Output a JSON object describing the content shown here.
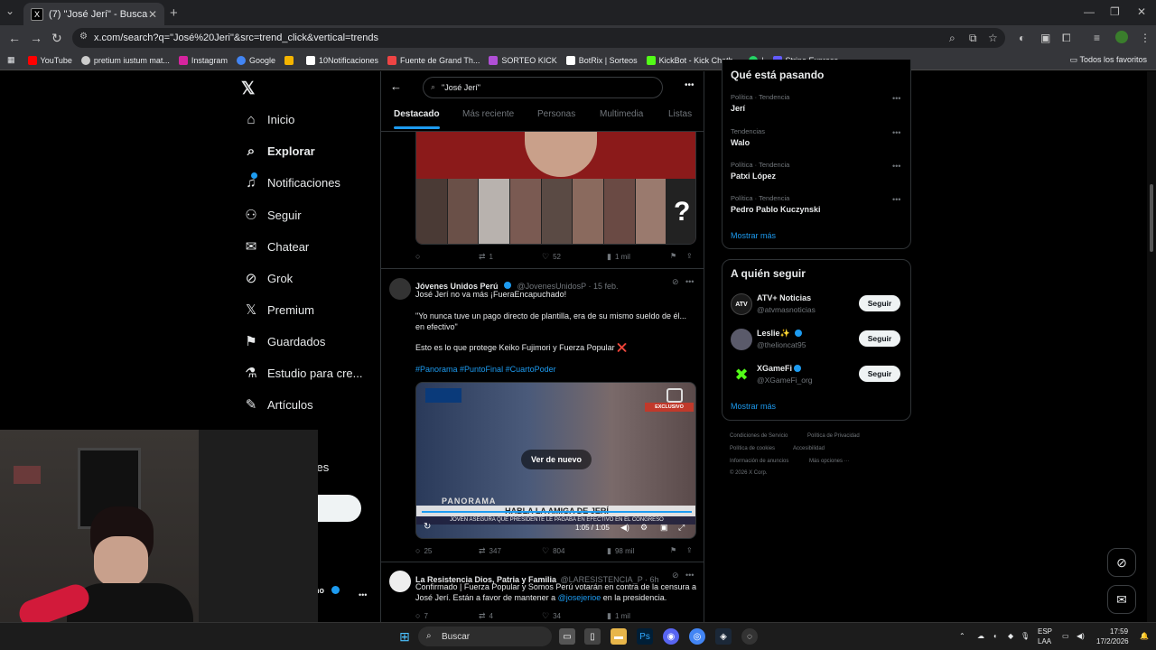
{
  "browser": {
    "tab_title": "(7) \"José Jerí\" - Buscar / X",
    "url": "x.com/search?q=\"José%20Jeri\"&src=trend_click&vertical=trends",
    "bookmarks": [
      {
        "label": "YouTube",
        "color": "#ff0000"
      },
      {
        "label": "pretium iustum mat...",
        "color": "#cccccc"
      },
      {
        "label": "Instagram",
        "color": "#d6249f"
      },
      {
        "label": "Google",
        "color": "#4285f4"
      },
      {
        "label": "",
        "color": "#f4b400"
      },
      {
        "label": "10Notificaciones",
        "color": "#ffffff"
      },
      {
        "label": "Fuente de Grand Th...",
        "color": "#e44"
      },
      {
        "label": "SORTEO KICK",
        "color": "#b04fd6"
      },
      {
        "label": "BotRix | Sorteos",
        "color": "#ffffff"
      },
      {
        "label": "KickBot - Kick Chatb...",
        "color": "#53fc18"
      },
      {
        "label": "|",
        "color": "#25d366"
      },
      {
        "label": "Stripe Express",
        "color": "#635bff"
      }
    ],
    "bookmarks_all": "Todos los favoritos"
  },
  "sidebar": {
    "items": [
      {
        "label": "Inicio",
        "icon": "home-icon"
      },
      {
        "label": "Explorar",
        "icon": "search-icon"
      },
      {
        "label": "Notificaciones",
        "icon": "bell-icon"
      },
      {
        "label": "Seguir",
        "icon": "add-user-icon"
      },
      {
        "label": "Chatear",
        "icon": "mail-icon"
      },
      {
        "label": "Grok",
        "icon": "grok-icon"
      },
      {
        "label": "Premium",
        "icon": "x-icon"
      },
      {
        "label": "Guardados",
        "icon": "bookmark-icon"
      },
      {
        "label": "Estudio para cre...",
        "icon": "flask-icon"
      },
      {
        "label": "Artículos",
        "icon": "article-icon"
      }
    ],
    "partial_label": "ones",
    "profile_partial": "ano"
  },
  "search": {
    "query": "\"José Jerí\"",
    "tabs": [
      "Destacado",
      "Más reciente",
      "Personas",
      "Multimedia",
      "Listas"
    ]
  },
  "tweets": [
    {
      "replies": "",
      "retweets": "1",
      "likes": "52",
      "views": "1 mil"
    },
    {
      "name": "Jóvenes Unidos Perú",
      "handle": "@JovenesUnidosP · 15 feb.",
      "line1": "José Jerí no va más ¡FueraEncapuchado!",
      "quote": "\"Yo nunca tuve un pago directo de plantilla, era de su mismo sueldo de él... en efectivo\"",
      "line3": "Esto es lo que protege Keiko Fujimori y Fuerza Popular ❌",
      "hashtags": "#Panorama #PuntoFinal #CuartoPoder",
      "video_replay": "Ver de nuevo",
      "video_time": "1:05 / 1:05",
      "video_caption": "HABLA LA AMIGA DE JERÍ",
      "video_sub": "JOVEN ASEGURA QUE PRESIDENTE LE PAGABA EN EFECTIVO EN EL CONGRESO",
      "video_brand": "PANORAMA",
      "video_badge": "EXCLUSIVO",
      "replies": "25",
      "retweets": "347",
      "likes": "804",
      "views": "98 mil"
    },
    {
      "name": "La Resistencia Dios, Patria y Familia",
      "handle": "@LARESISTENCIA_P · 6h",
      "text_a": "Confirmado | Fuerza Popular y Somos Perú votarán en contra de la censura a José Jerí. Están a favor de mantener a ",
      "mention": "@josejerioe",
      "text_b": " en la presidencia.",
      "replies": "7",
      "retweets": "4",
      "likes": "34",
      "views": "1 mil"
    }
  ],
  "trends": {
    "title": "Qué está pasando",
    "items": [
      {
        "meta": "Política · Tendencia",
        "name": "Jerí"
      },
      {
        "meta": "Tendencias",
        "name": "Walo"
      },
      {
        "meta": "Política · Tendencia",
        "name": "Patxi López"
      },
      {
        "meta": "Política · Tendencia",
        "name": "Pedro Pablo Kuczynski"
      }
    ],
    "more": "Mostrar más"
  },
  "who_to_follow": {
    "title": "A quién seguir",
    "accounts": [
      {
        "name": "ATV+ Noticias",
        "handle": "@atvmasnoticias",
        "button": "Seguir",
        "avatar_text": "ATV"
      },
      {
        "name": "Leslie✨",
        "handle": "@thelioncat95",
        "button": "Seguir",
        "avatar_text": ""
      },
      {
        "name": "XGameFi",
        "handle": "@XGameFi_org",
        "button": "Seguir",
        "avatar_text": ""
      }
    ],
    "more": "Mostrar más"
  },
  "footer": {
    "links": [
      "Condiciones de Servicio",
      "Política de Privacidad",
      "Política de cookies",
      "Accesibilidad",
      "Información de anuncios",
      "Más opciones ···"
    ],
    "copyright": "© 2026 X Corp."
  },
  "taskbar": {
    "search": "Buscar",
    "lang": "ESP",
    "lang2": "LAA",
    "time": "17:59",
    "date": "17/2/2026"
  }
}
